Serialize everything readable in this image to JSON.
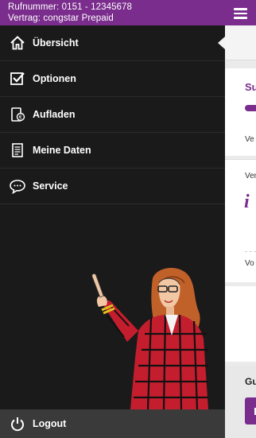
{
  "header": {
    "rufnummer_label": "Rufnummer:",
    "rufnummer_value": "0151 - 12345678",
    "vertrag_label": "Vertrag:",
    "vertrag_value": "congstar Prepaid"
  },
  "menu": {
    "items": [
      {
        "label": "Übersicht",
        "icon": "home-icon",
        "active": true
      },
      {
        "label": "Optionen",
        "icon": "checkbox-icon",
        "active": false
      },
      {
        "label": "Aufladen",
        "icon": "topup-icon",
        "active": false
      },
      {
        "label": "Meine Daten",
        "icon": "document-icon",
        "active": false
      },
      {
        "label": "Service",
        "icon": "chat-bubble-icon",
        "active": false
      }
    ],
    "logout_label": "Logout"
  },
  "content": {
    "card1_title": "Su",
    "card1_text": "Ve",
    "card2_text": "Ver",
    "card2_info": "i",
    "card2_bottom": "Vo",
    "card4_title": "Gu"
  },
  "colors": {
    "brand": "#7a2d8c",
    "drawer_bg": "#1a1a1a",
    "logout_bg": "#3a3a3a"
  }
}
